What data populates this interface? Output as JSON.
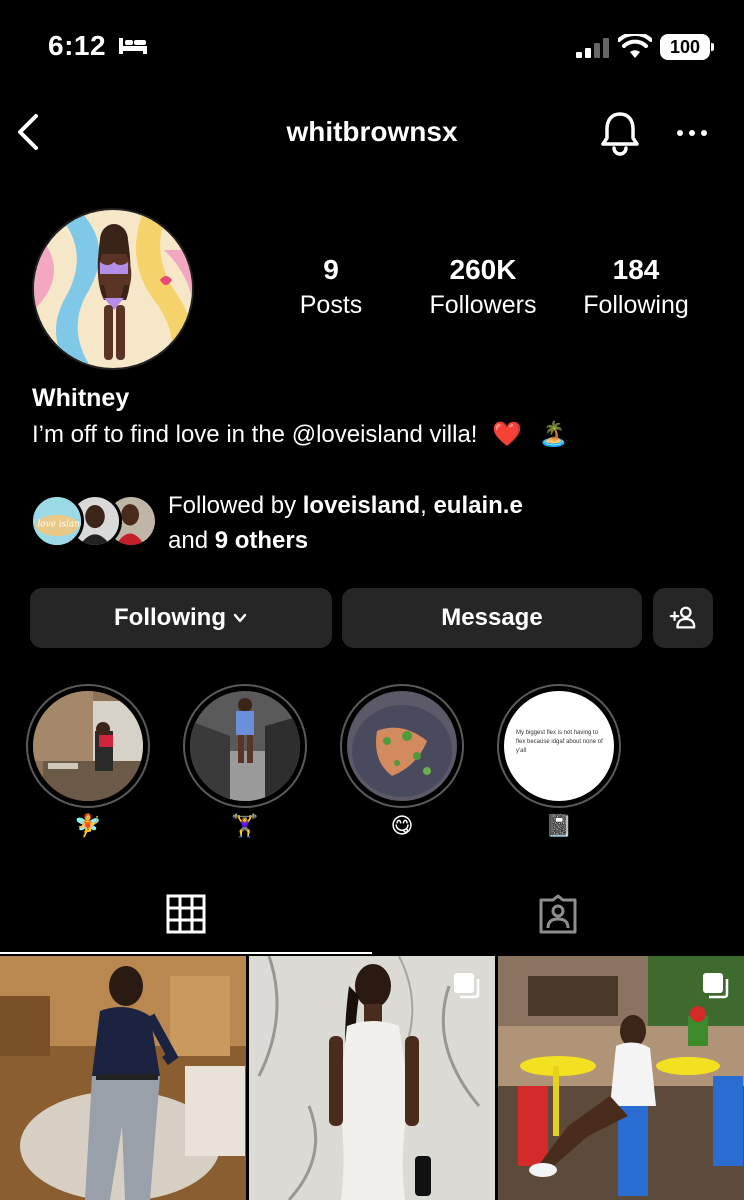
{
  "status_bar": {
    "time": "6:12",
    "battery": "100",
    "icons": [
      "bed-icon",
      "signal-icon",
      "wifi-icon",
      "battery-icon"
    ]
  },
  "header": {
    "username": "whitbrownsx",
    "icons": [
      "back-icon",
      "bell-icon",
      "more-icon"
    ]
  },
  "profile": {
    "stats": [
      {
        "value": "9",
        "label": "Posts"
      },
      {
        "value": "260K",
        "label": "Followers"
      },
      {
        "value": "184",
        "label": "Following"
      }
    ],
    "display_name": "Whitney",
    "bio_text": "I’m off to find love in the @loveisland villa!",
    "bio_emoji_1": "❤️",
    "bio_emoji_2": "🏝️",
    "followed_by_prefix": "Followed by ",
    "followed_by_user1": "loveisland",
    "followed_by_sep": ", ",
    "followed_by_user2": "eulain.e",
    "followed_by_and": "and ",
    "followed_by_others": "9 others"
  },
  "actions": {
    "following_label": "Following",
    "message_label": "Message"
  },
  "highlights": [
    {
      "label": "🧚"
    },
    {
      "label": "🏋️‍♀️"
    },
    {
      "label": "😋"
    },
    {
      "label": "📓",
      "text": "My biggest flex is not having to flex because idgaf about none of y'all"
    }
  ],
  "tabs": [
    "grid-tab",
    "tagged-tab"
  ],
  "mini_avatar_text": "love island",
  "colors": {
    "background": "#000000",
    "button_bg": "#262626",
    "text": "#ffffff",
    "heart": "#e0245e"
  }
}
